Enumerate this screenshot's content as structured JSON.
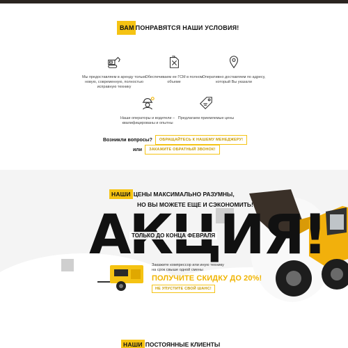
{
  "section_conditions": {
    "title_highlight": "ВАМ",
    "title_rest": "ПОНРАВЯТСЯ НАШИ УСЛОВИЯ!",
    "features": [
      {
        "icon": "excavator-icon",
        "text": "Мы предоставляем в аренду только новую, современную, полностью исправную технику"
      },
      {
        "icon": "fuel-canister-icon",
        "text": "Обеспечиваем ее ГСМ в полном объеме"
      },
      {
        "icon": "location-pin-icon",
        "text": "Оперативно доставляем по адресу, который Вы указали"
      },
      {
        "icon": "worker-helmet-icon",
        "text": "Наши операторы и водители – квалифицированы и опытны"
      },
      {
        "icon": "price-tag-icon",
        "text": "Предлагаем приемлемые цены"
      }
    ],
    "question_label": "Возникли вопросы?",
    "manager_button": "ОБРАЩАЙТЕСЬ К НАШЕМУ МЕНЕДЖЕРУ!",
    "or_label": "или",
    "callback_button": "ЗАКАЖИТЕ ОБРАТНЫЙ ЗВОНОК!"
  },
  "promo": {
    "headline_highlight": "НАШИ",
    "headline_rest": "ЦЕНЫ МАКСИМАЛЬНО РАЗУМНЫ,",
    "headline_line2": "НО ВЫ МОЖЕТЕ ЕЩЕ И СЭКОНОМИТЬ!",
    "big_word": "АКЦИЯ!",
    "deadline": "ТОЛЬКО ДО КОНЦА ФЕВРАЛЯ",
    "offer_line1": "Закажите компрессор или иную технику",
    "offer_line2": "на срок свыше одной смены",
    "discount": "ПОЛУЧИТЕ СКИДКУ ДО 20%!",
    "cta_button": "НЕ УПУСТИТЕ СВОЙ ШАНС!",
    "accent_color": "#f5c313"
  },
  "section_clients": {
    "title_highlight": "НАШИ",
    "title_rest": "ПОСТОЯННЫЕ КЛИЕНТЫ"
  }
}
